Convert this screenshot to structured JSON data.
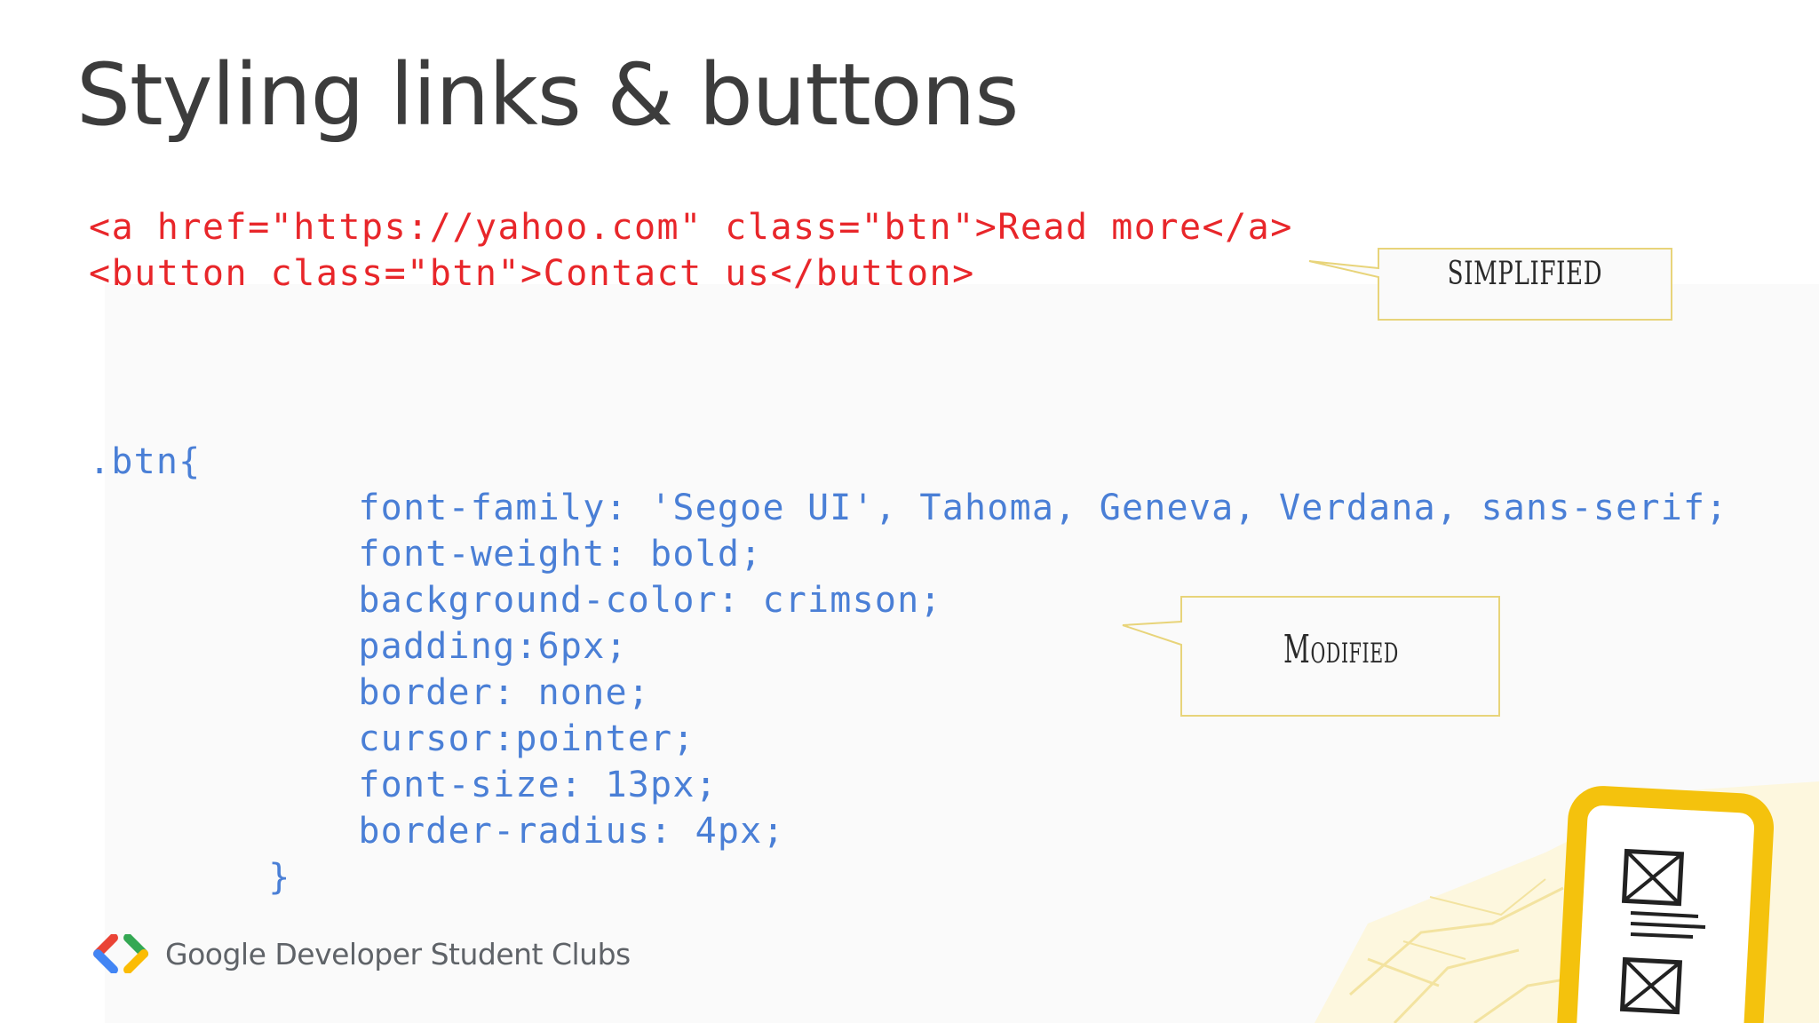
{
  "slide": {
    "title": "Styling links & buttons"
  },
  "html_code": {
    "lines": [
      "<a href=\"https://yahoo.com\" class=\"btn\">Read more</a>",
      "<button class=\"btn\">Contact us</button>"
    ]
  },
  "css_code": {
    "lines": [
      ".btn{",
      "            font-family: 'Segoe UI', Tahoma, Geneva, Verdana, sans-serif;",
      "            font-weight: bold;",
      "            background-color: crimson;",
      "            padding:6px;",
      "            border: none;",
      "            cursor:pointer;",
      "            font-size: 13px;",
      "            border-radius: 4px;",
      "        }"
    ]
  },
  "callouts": {
    "first": "SIMPLIFIED",
    "second": "Modified"
  },
  "footer": {
    "brand": "Google Developer Student Clubs"
  },
  "colors": {
    "title": "#3c3c3c",
    "html_code": "#e8262a",
    "css_code": "#4a7fd6",
    "callout_border": "#e8d47a",
    "logo_blue": "#4285f4",
    "logo_red": "#ea4335",
    "logo_green": "#34a853",
    "logo_yellow": "#fbbc04",
    "deco_yellow": "#f4c20d"
  },
  "icons": {
    "logo": "gdsc-chevron-logo",
    "illustration": "phone-wireframe-illustration"
  }
}
